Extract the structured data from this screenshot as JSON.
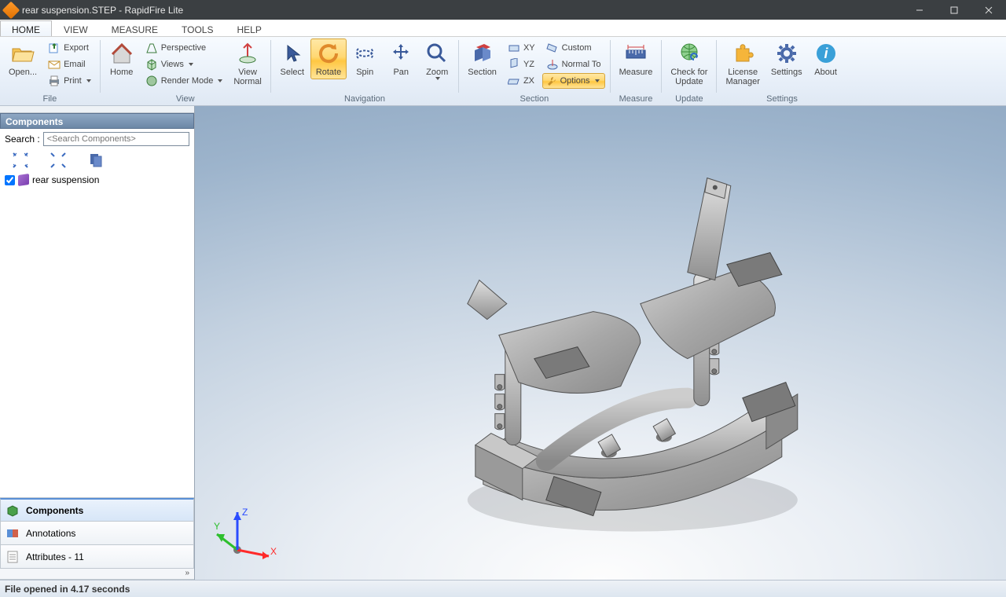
{
  "window": {
    "title": "rear suspension.STEP - RapidFire Lite"
  },
  "tabs": [
    "HOME",
    "VIEW",
    "MEASURE",
    "TOOLS",
    "HELP"
  ],
  "ribbon": {
    "file": {
      "open": "Open...",
      "export": "Export",
      "email": "Email",
      "print": "Print",
      "label": "File"
    },
    "view": {
      "home": "Home",
      "perspective": "Perspective",
      "views": "Views",
      "render_mode": "Render Mode",
      "view_normal": "View\nNormal",
      "label": "View"
    },
    "navigation": {
      "select": "Select",
      "rotate": "Rotate",
      "spin": "Spin",
      "pan": "Pan",
      "zoom": "Zoom",
      "label": "Navigation"
    },
    "section": {
      "section": "Section",
      "xy": "XY",
      "yz": "YZ",
      "zx": "ZX",
      "custom": "Custom",
      "normal_to": "Normal To",
      "options": "Options",
      "label": "Section"
    },
    "measure": {
      "measure": "Measure",
      "label": "Measure"
    },
    "update": {
      "check": "Check for\nUpdate",
      "label": "Update"
    },
    "settings": {
      "license": "License\nManager",
      "settings": "Settings",
      "about": "About",
      "label": "Settings"
    }
  },
  "side": {
    "panel_title": "Components",
    "search_label": "Search :",
    "search_placeholder": "<Search Components>",
    "root_item": "rear suspension",
    "tabs": {
      "components": "Components",
      "annotations": "Annotations",
      "attributes": "Attributes - 11"
    }
  },
  "triad": {
    "x": "X",
    "y": "Y",
    "z": "Z"
  },
  "status": "File opened in 4.17 seconds"
}
